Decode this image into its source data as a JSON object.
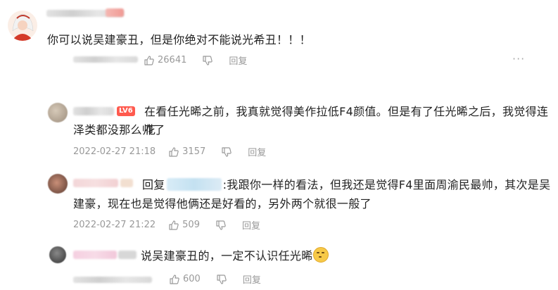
{
  "comments": [
    {
      "text": "你可以说吴建豪丑，但是你绝对不能说光希丑！！！",
      "likes": "26641",
      "reply_label": "回复",
      "more": "···"
    },
    {
      "badge": "LV6",
      "text_line1": "在看任光晞之前，我真就觉得美作拉低F4颜值。但是有了任光晞之后，我觉得连花",
      "text_line2": "泽类都没那么帅了",
      "date": "2022-02-27 21:18",
      "likes": "3157",
      "reply_label": "回复"
    },
    {
      "reply_prefix": "回复",
      "text_line1": ":我跟你一样的看法，但我还是觉得F4里面周渝民最帅，其次是吴",
      "text_line2": "建豪，现在也是觉得他俩还是好看的，另外两个就很一般了",
      "date": "2022-02-27 21:22",
      "likes": "509",
      "reply_label": "回复"
    },
    {
      "text": "说吴建豪丑的，一定不认识任光晞",
      "likes": "600",
      "reply_label": "回复",
      "emoji": "smirk-emoji"
    }
  ],
  "colors": {
    "text": "#222222",
    "meta": "#999999",
    "badge": "#ff5a4e"
  }
}
